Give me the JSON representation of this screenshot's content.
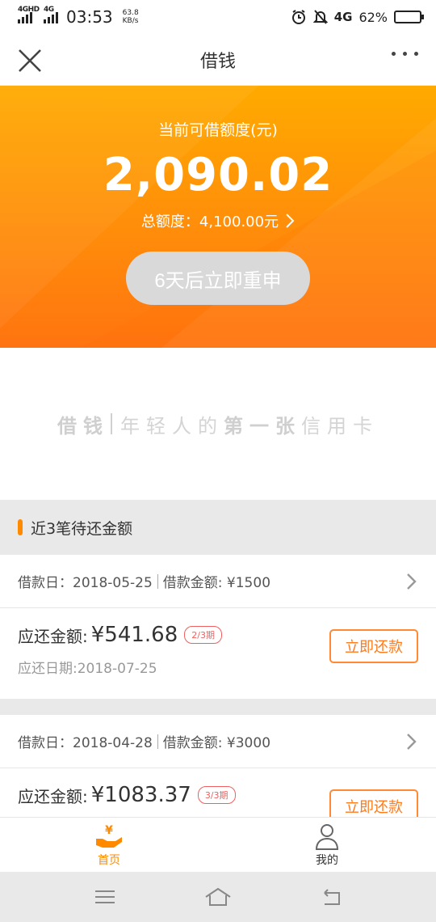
{
  "status_bar": {
    "sim1": "4GHD",
    "sim2": "4G",
    "time": "03:53",
    "net_speed_value": "63.8",
    "net_speed_unit": "KB/s",
    "network": "4G",
    "battery": "62%",
    "battery_level": 0.62
  },
  "nav": {
    "title": "借钱"
  },
  "hero": {
    "label": "当前可借额度(元)",
    "amount": "2,090.02",
    "total": "总额度：4,100.00元",
    "button": "6天后立即重申"
  },
  "slogan": {
    "brand": "借钱",
    "part1": "年轻人的",
    "part2": "第一张",
    "part3": "信用卡"
  },
  "section": {
    "title": "近3笔待还金额"
  },
  "loans": [
    {
      "loan_date": "借款日：2018-05-25",
      "loan_amount": "借款金额: ¥1500",
      "due_label": "应还金额:",
      "due_amount": "¥541.68",
      "period": "2/3期",
      "due_date": "应还日期:2018-07-25",
      "button": "立即还款"
    },
    {
      "loan_date": "借款日：2018-04-28",
      "loan_amount": "借款金额: ¥3000",
      "due_label": "应还金额:",
      "due_amount": "¥1083.37",
      "period": "3/3期",
      "due_date": "",
      "button": "立即还款"
    }
  ],
  "tabs": [
    {
      "label": "首页",
      "icon": "home-hand-yen-icon",
      "active": true
    },
    {
      "label": "我的",
      "icon": "user-icon",
      "active": false
    }
  ],
  "colors": {
    "orange": "#ff8a00",
    "orange_light": "#ffaa00",
    "badge_red": "#f06060"
  }
}
